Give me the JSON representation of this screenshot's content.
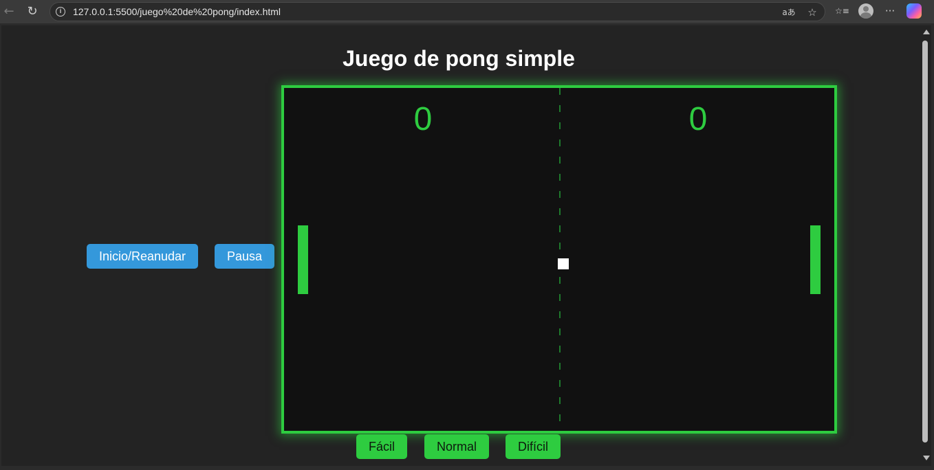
{
  "browser": {
    "url": "127.0.0.1:5500/juego%20de%20pong/index.html",
    "icons": {
      "back": "back-arrow-icon",
      "reload": "reload-icon",
      "info": "info-icon",
      "translate": "translate-icon",
      "favorite": "star-icon",
      "favorites_list": "favorites-list-icon",
      "profile": "profile-avatar",
      "more": "more-icon",
      "copilot": "copilot-icon"
    },
    "glyphs": {
      "back": "←",
      "reload": "↻",
      "info": "i",
      "translate": "aあ",
      "favorite": "☆",
      "favorites_list": "☆≡",
      "more": "···"
    }
  },
  "page": {
    "title": "Juego de pong simple",
    "controls": {
      "start": "Inicio/Reanudar",
      "pause": "Pausa"
    },
    "difficulty": {
      "easy": "Fácil",
      "normal": "Normal",
      "hard": "Difícil"
    }
  },
  "game": {
    "score_left": "0",
    "score_right": "0",
    "accent_color": "#2ecc40",
    "button_color": "#3498db",
    "background_color": "#111111"
  }
}
